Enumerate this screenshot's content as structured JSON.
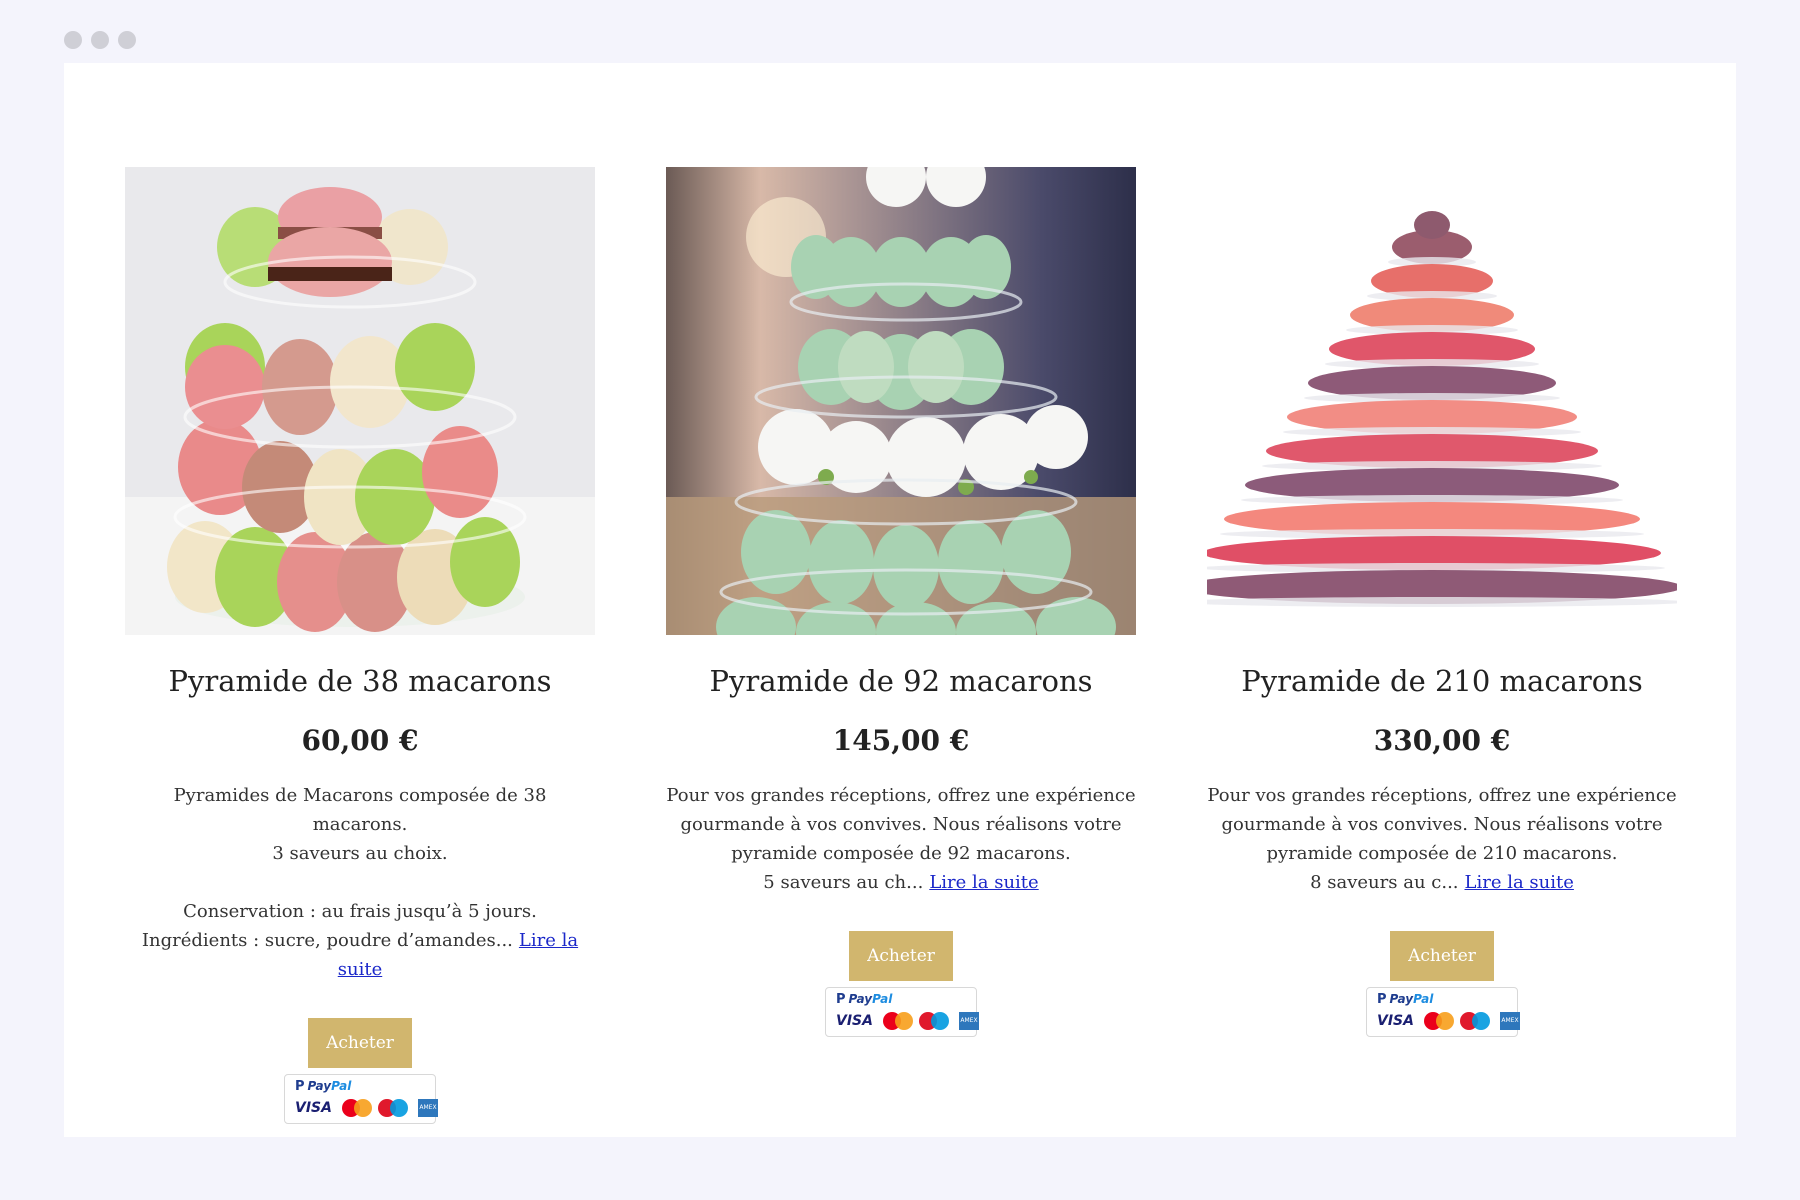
{
  "products": [
    {
      "name": "Pyramide de 38 macarons",
      "price": "60,00 €",
      "desc_lines": [
        "Pyramides de Macarons composée de 38 macarons.",
        "3 saveurs au choix.",
        "",
        "Conservation : au frais jusqu’à 5 jours.",
        "Ingrédients : sucre, poudre d’amandes..."
      ],
      "read_more": "Lire la suite",
      "buy_label": "Acheter",
      "image": "macaron-tower-small-photo"
    },
    {
      "name": "Pyramide de 92 macarons",
      "price": "145,00 €",
      "desc_lines": [
        "Pour vos grandes réceptions, offrez une expérience",
        "gourmande à vos convives. Nous réalisons votre",
        "pyramide composée de 92 macarons.",
        "5 saveurs au ch..."
      ],
      "read_more": "Lire la suite",
      "buy_label": "Acheter",
      "image": "macaron-tower-green-roses-photo"
    },
    {
      "name": "Pyramide de 210 macarons",
      "price": "330,00 €",
      "desc_lines": [
        "Pour vos grandes réceptions, offrez une expérience",
        "gourmande à vos convives. Nous réalisons votre",
        "pyramide composée de 210 macarons.",
        "8 saveurs au c..."
      ],
      "read_more": "Lire la suite",
      "buy_label": "Acheter",
      "image": "macaron-tower-large-photo"
    }
  ],
  "payment": {
    "paypal_p": "P",
    "paypal_pay": "Pay",
    "paypal_pal": "Pal",
    "visa": "VISA",
    "amex": "AMEX"
  },
  "colors": {
    "buy_button": "#d1b66e",
    "link": "#1a27c9",
    "page_bg": "#f4f4fc"
  }
}
